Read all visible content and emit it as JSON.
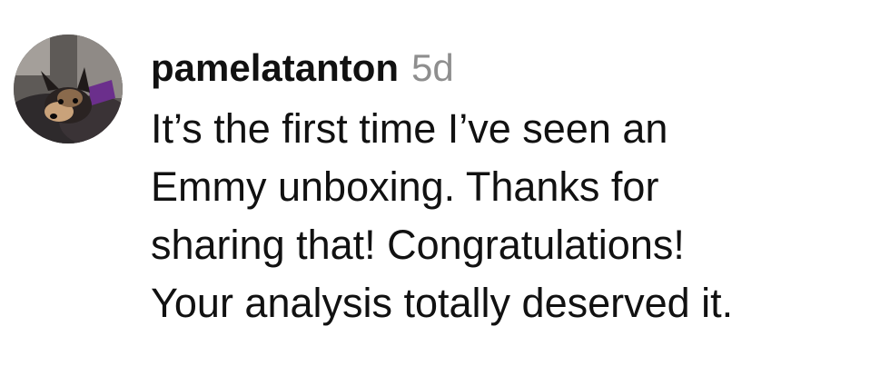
{
  "comment": {
    "username": "pamelatanton",
    "time": "5d",
    "lines": [
      "It’s the first time I’ve seen an",
      "Emmy unboxing. Thanks for",
      "sharing that! Congratulations!",
      "Your analysis totally deserved it."
    ],
    "avatar_icon": "user-avatar-dog-photo-icon"
  },
  "colors": {
    "username": "#111111",
    "timestamp": "#8e8e8e",
    "text": "#111111",
    "background": "#ffffff"
  }
}
